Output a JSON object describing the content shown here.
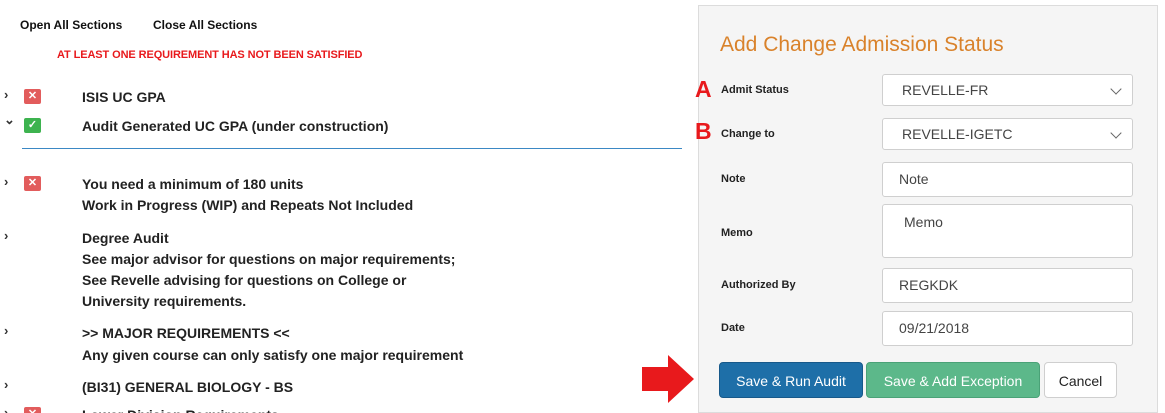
{
  "toolbar": {
    "open_all": "Open All Sections",
    "close_all": "Close All Sections"
  },
  "warning": "AT LEAST ONE REQUIREMENT HAS NOT BEEN SATISFIED",
  "audit_rows": [
    {
      "chevron": "›",
      "status": "unsatisfied",
      "lines": [
        "ISIS UC GPA"
      ]
    },
    {
      "chevron": "⌄",
      "status": "satisfied",
      "lines": [
        "Audit Generated UC GPA (under construction)"
      ]
    },
    {
      "chevron": "›",
      "status": "unsatisfied",
      "lines": [
        "You need a minimum of 180 units",
        "Work in Progress (WIP) and Repeats Not Included"
      ]
    },
    {
      "chevron": "›",
      "status": "none",
      "lines": [
        "Degree Audit",
        "See major advisor for questions on major requirements;",
        "See Revelle advising for questions on College or",
        "University requirements."
      ]
    },
    {
      "chevron": "›",
      "status": "none",
      "lines": [
        ">> MAJOR REQUIREMENTS <<",
        "Any given course can only satisfy one major requirement"
      ]
    },
    {
      "chevron": "›",
      "status": "none",
      "lines": [
        "(BI31) GENERAL BIOLOGY - BS"
      ]
    },
    {
      "chevron": "›",
      "status": "unsatisfied",
      "lines": [
        "Lower Division Requirements"
      ]
    }
  ],
  "form": {
    "title": "Add Change Admission Status",
    "admit_status": {
      "label": "Admit Status",
      "value": "REVELLE-FR"
    },
    "change_to": {
      "label": "Change to",
      "value": "REVELLE-IGETC"
    },
    "note": {
      "label": "Note",
      "placeholder": "Note"
    },
    "memo": {
      "label": "Memo",
      "placeholder": "Memo"
    },
    "authorized_by": {
      "label": "Authorized By",
      "value": "REGKDK"
    },
    "date": {
      "label": "Date",
      "value": "09/21/2018"
    }
  },
  "buttons": {
    "save_run": "Save & Run Audit",
    "save_exception": "Save & Add Exception",
    "cancel": "Cancel"
  },
  "annotations": {
    "a": "A",
    "b": "B"
  },
  "colors": {
    "title": "#d9822b",
    "warning": "#e8191c",
    "primary": "#1e6fa8",
    "success": "#5cb88a",
    "divider": "#3b88c4",
    "status_red": "#e25c5c",
    "status_green": "#3db34f"
  }
}
